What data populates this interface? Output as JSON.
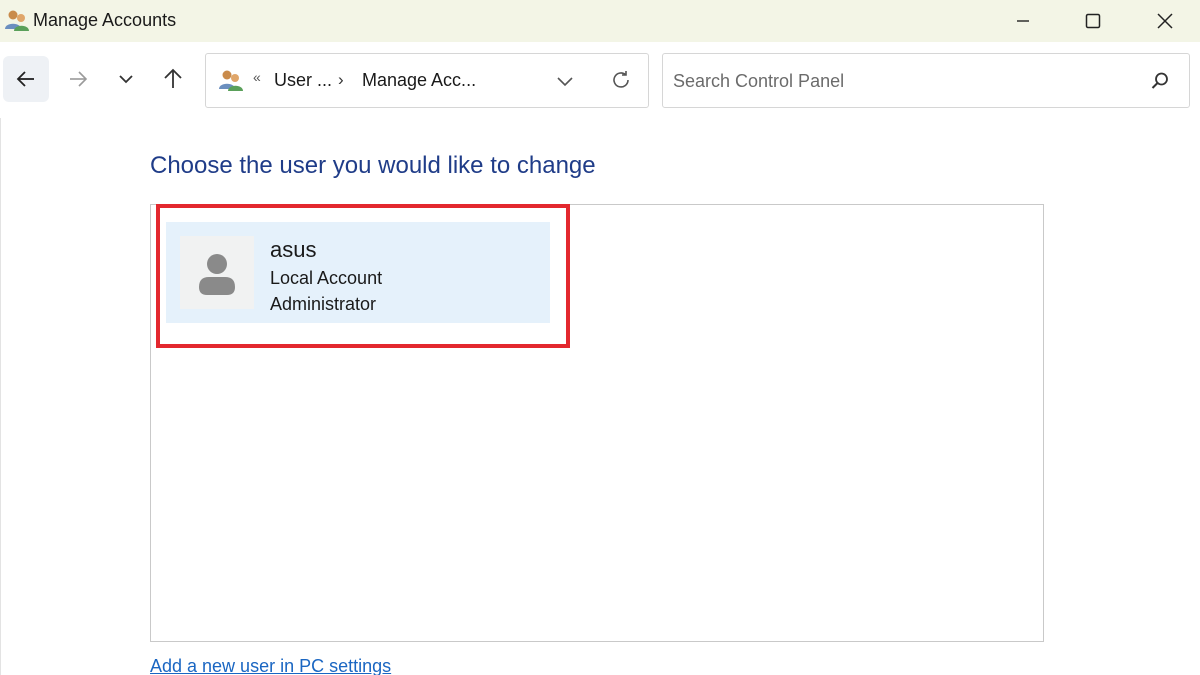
{
  "window": {
    "title": "Manage Accounts",
    "icon": "users-icon",
    "controls": [
      "minimize-icon",
      "maximize-icon",
      "close-icon"
    ]
  },
  "nav": {
    "back_icon": "arrow-left-icon",
    "forward_icon": "arrow-right-icon",
    "recent_icon": "chevron-down-icon",
    "up_icon": "arrow-up-icon"
  },
  "address": {
    "separator": "«",
    "crumbs": [
      {
        "label": "User ..."
      },
      {
        "label": "Manage Acc..."
      }
    ],
    "crumb_arrow": "›",
    "dropdown_icon": "chevron-down-icon",
    "refresh_icon": "refresh-icon"
  },
  "search": {
    "placeholder": "Search Control Panel",
    "value": "",
    "icon": "search-icon"
  },
  "main": {
    "heading": "Choose the user you would like to change",
    "users": [
      {
        "name": "asus",
        "type": "Local Account",
        "role": "Administrator"
      }
    ],
    "add_user_link": "Add a new user in PC settings"
  },
  "colors": {
    "heading": "#1f3c88",
    "selection": "#e5f1fb",
    "highlight": "#e3282e",
    "link": "#1a66c2",
    "titlebar": "#f3f5e6"
  }
}
